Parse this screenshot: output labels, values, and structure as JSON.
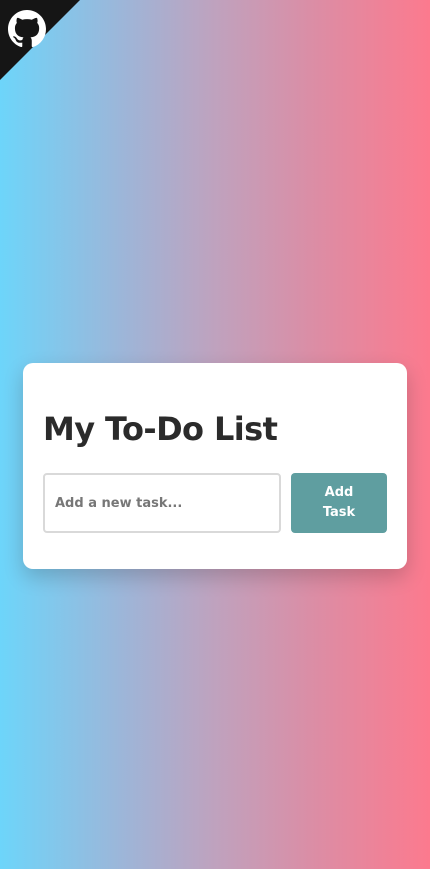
{
  "corner_badge": {
    "icon": "github-octocat-icon",
    "background_color": "#151515",
    "icon_color": "#ffffff"
  },
  "background": {
    "gradient_start": "#6dd5fa",
    "gradient_end": "#fc7a8e"
  },
  "todo": {
    "title": "My To-Do List",
    "input": {
      "placeholder": "Add a new task...",
      "value": ""
    },
    "add_button_label": "Add Task",
    "accent_color": "#5f9ea0",
    "tasks": []
  }
}
